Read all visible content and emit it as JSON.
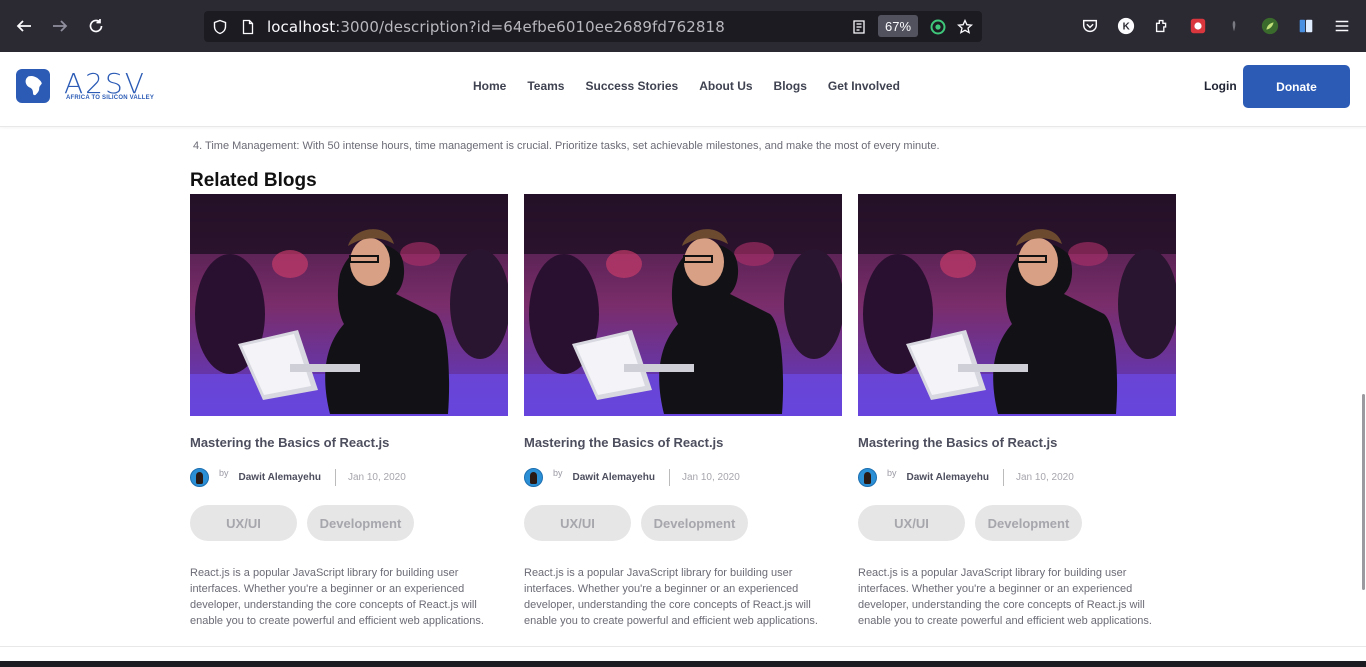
{
  "browser": {
    "url_host": "localhost",
    "url_rest": ":3000/description?id=64efbe6010ee2689fd762818",
    "zoom": "67%",
    "icons": [
      "back-icon",
      "forward-icon",
      "reload-icon",
      "shield-icon",
      "page-icon",
      "reader-icon",
      "star-icon",
      "pocket-icon",
      "extension-k-icon",
      "extensions-icon",
      "menu-icon"
    ]
  },
  "header": {
    "logo_text": "A2SV",
    "logo_sub": "AFRICA TO SILICON VALLEY",
    "nav": [
      "Home",
      "Teams",
      "Success Stories",
      "About Us",
      "Blogs",
      "Get Involved"
    ],
    "login": "Login",
    "donate": "Donate",
    "brand_color": "#2b5bb5"
  },
  "content": {
    "list_item": "4. Time Management: With 50 intense hours, time management is crucial. Prioritize tasks, set achievable milestones, and make the most of every minute.",
    "related_title": "Related Blogs"
  },
  "cards": [
    {
      "title": "Mastering the Basics of React.js",
      "by": "by",
      "author": "Dawit Alemayehu",
      "date": "Jan 10, 2020",
      "tags": [
        "UX/UI",
        "Development"
      ],
      "description": "React.js is a popular JavaScript library for building user interfaces. Whether you're a beginner or an experienced developer, understanding the core concepts of React.js will enable you to create powerful and efficient web applications."
    },
    {
      "title": "Mastering the Basics of React.js",
      "by": "by",
      "author": "Dawit Alemayehu",
      "date": "Jan 10, 2020",
      "tags": [
        "UX/UI",
        "Development"
      ],
      "description": "React.js is a popular JavaScript library for building user interfaces. Whether you're a beginner or an experienced developer, understanding the core concepts of React.js will enable you to create powerful and efficient web applications."
    },
    {
      "title": "Mastering the Basics of React.js",
      "by": "by",
      "author": "Dawit Alemayehu",
      "date": "Jan 10, 2020",
      "tags": [
        "UX/UI",
        "Development"
      ],
      "description": "React.js is a popular JavaScript library for building user interfaces. Whether you're a beginner or an experienced developer, understanding the core concepts of React.js will enable you to create powerful and efficient web applications."
    }
  ]
}
